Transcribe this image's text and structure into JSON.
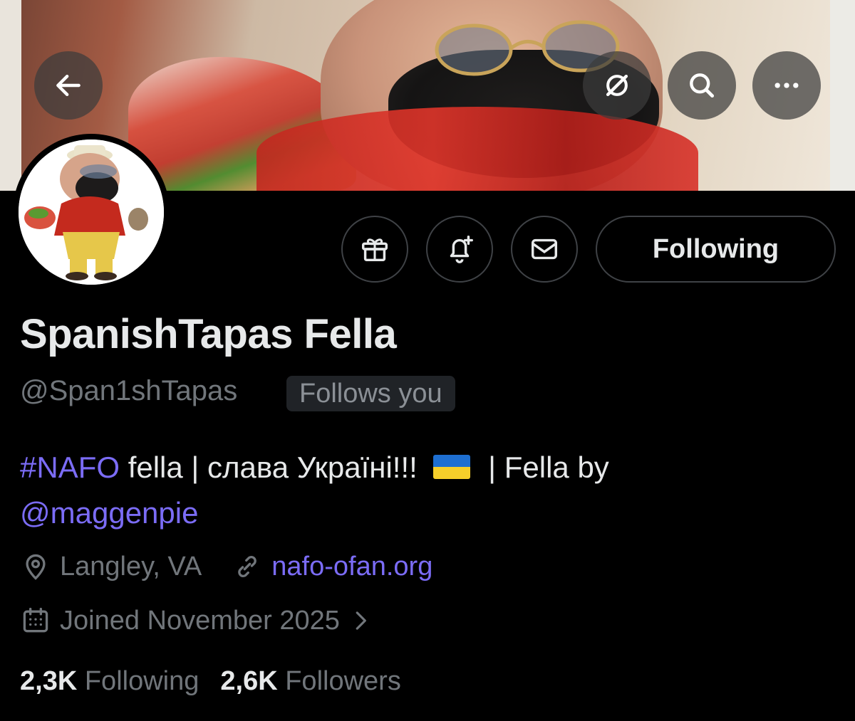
{
  "header": {
    "back_icon": "arrow-left-icon",
    "grok_icon": "grok-icon",
    "search_icon": "search-icon",
    "more_icon": "more-horizontal-icon"
  },
  "actions": {
    "gift_icon": "gift-icon",
    "notify_icon": "bell-plus-icon",
    "message_icon": "envelope-icon",
    "following_label": "Following"
  },
  "profile": {
    "display_name": "SpanishTapas Fella",
    "handle": "@Span1shTapas",
    "follows_you": "Follows you",
    "bio": {
      "hashtag": "#NAFO",
      "text1": " fella | слава Україні!!! ",
      "text2": " | Fella by",
      "mention": "@maggenpie"
    },
    "location": "Langley, VA",
    "website": "nafo-ofan.org",
    "joined": "Joined November 2025",
    "following_count": "2,3K",
    "following_label": "Following",
    "followers_count": "2,6K",
    "followers_label": "Followers"
  },
  "colors": {
    "link": "#7b6cf6",
    "muted": "#71767b",
    "text": "#e7e9ea",
    "background": "#000000"
  }
}
